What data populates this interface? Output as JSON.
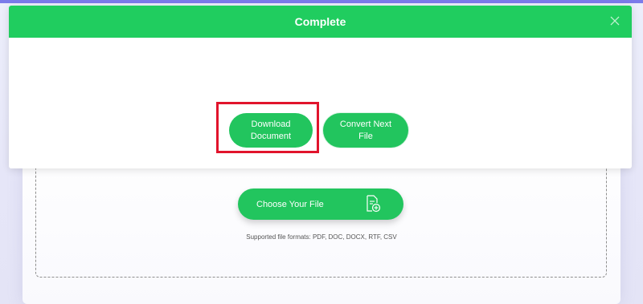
{
  "modal": {
    "title": "Complete",
    "close_icon": "close-icon",
    "download_label_line1": "Download",
    "download_label_line2": "Document",
    "convert_label_line1": "Convert Next",
    "convert_label_line2": "File",
    "highlight_color": "#e1142c"
  },
  "uploader": {
    "choose_label": "Choose Your File",
    "choose_icon": "add-file-icon",
    "formats_text": "Supported file formats: PDF, DOC, DOCX, RTF, CSV"
  },
  "colors": {
    "accent": "#20cd5f",
    "button": "#22c55e",
    "top_strip": "#7b7bea"
  }
}
